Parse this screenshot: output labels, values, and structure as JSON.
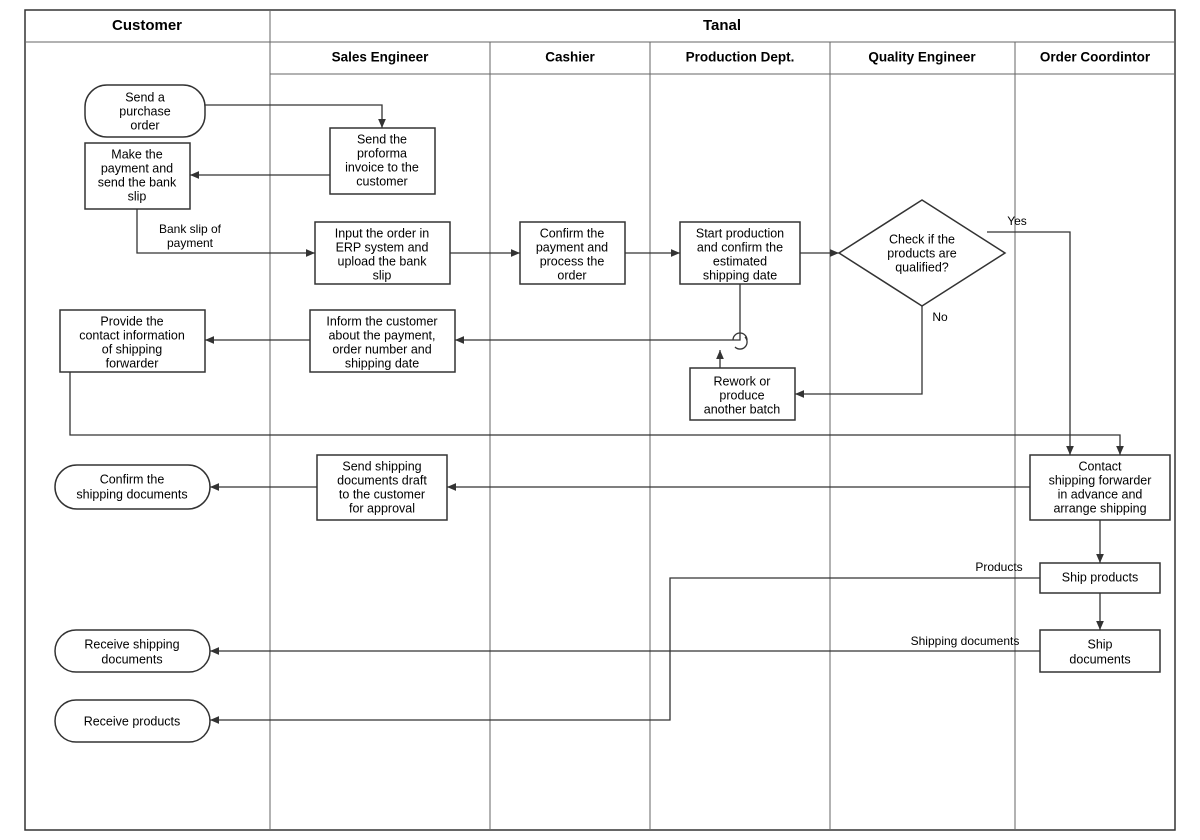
{
  "swimlanes": {
    "customer": "Customer",
    "tanal": "Tanal",
    "sub": {
      "salesEngineer": "Sales Engineer",
      "cashier": "Cashier",
      "productionDept": "Production Dept.",
      "qualityEngineer": "Quality Engineer",
      "orderCoordinator": "Order Coordintor"
    }
  },
  "nodes": {
    "sendPO1": "Send a",
    "sendPO2": "purchase",
    "sendPO3": "order",
    "proforma1": "Send the",
    "proforma2": "proforma",
    "proforma3": "invoice to the",
    "proforma4": "customer",
    "makePay1": "Make the",
    "makePay2": "payment and",
    "makePay3": "send the bank",
    "makePay4": "slip",
    "erp1": "Input the order in",
    "erp2": "ERP system and",
    "erp3": "upload the bank",
    "erp4": "slip",
    "confirmPay1": "Confirm the",
    "confirmPay2": "payment and",
    "confirmPay3": "process the",
    "confirmPay4": "order",
    "startProd1": "Start production",
    "startProd2": "and confirm the",
    "startProd3": "estimated",
    "startProd4": "shipping date",
    "check1": "Check if the",
    "check2": "products are",
    "check3": "qualified?",
    "informCust1": "Inform the customer",
    "informCust2": "about the payment,",
    "informCust3": "order number and",
    "informCust4": "shipping date",
    "provideContact1": "Provide the",
    "provideContact2": "contact information",
    "provideContact3": "of shipping",
    "provideContact4": "forwarder",
    "rework1": "Rework or",
    "rework2": "produce",
    "rework3": "another batch",
    "contactFwd1": "Contact",
    "contactFwd2": "shipping forwarder",
    "contactFwd3": "in advance and",
    "contactFwd4": "arrange shipping",
    "sendDraft1": "Send shipping",
    "sendDraft2": "documents draft",
    "sendDraft3": "to the customer",
    "sendDraft4": "for approval",
    "confirmDocs1": "Confirm the",
    "confirmDocs2": "shipping documents",
    "shipProducts": "Ship products",
    "shipDocs1": "Ship",
    "shipDocs2": "documents",
    "recvDocs1": "Receive shipping",
    "recvDocs2": "documents",
    "recvProd": "Receive products"
  },
  "edgeLabels": {
    "bankSlip1": "Bank slip of",
    "bankSlip2": "payment",
    "yes": "Yes",
    "no": "No",
    "products": "Products",
    "shippingDocs": "Shipping documents"
  }
}
